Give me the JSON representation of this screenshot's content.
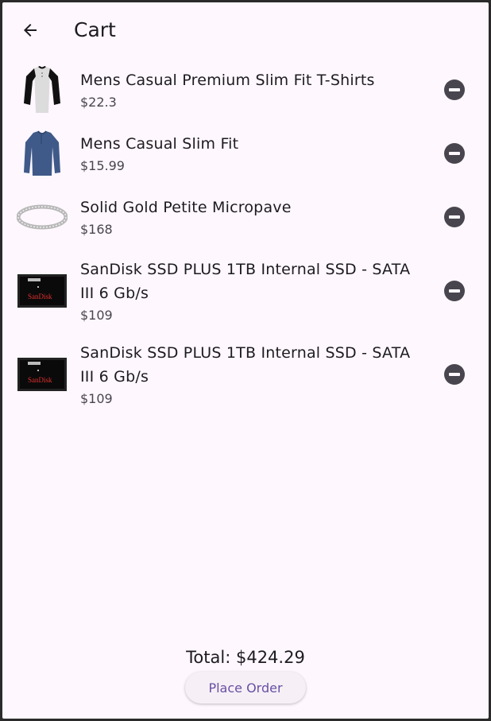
{
  "appbar": {
    "title": "Cart",
    "back_icon": "arrow-left-icon"
  },
  "items": [
    {
      "name": "Mens Casual Premium Slim Fit T-Shirts",
      "price": "$22.3",
      "image": "raglan-tshirt-image"
    },
    {
      "name": "Mens Casual Slim Fit",
      "price": "$15.99",
      "image": "blue-longsleeve-image"
    },
    {
      "name": "Solid Gold Petite Micropave",
      "price": "$168",
      "image": "silver-bracelet-image"
    },
    {
      "name": "SanDisk SSD PLUS 1TB Internal SSD - SATA III 6 Gb/s",
      "price": "$109",
      "image": "sandisk-ssd-image",
      "image_text": "SanDisk"
    },
    {
      "name": "SanDisk SSD PLUS 1TB Internal SSD - SATA III 6 Gb/s",
      "price": "$109",
      "image": "sandisk-ssd-image",
      "image_text": "SanDisk"
    }
  ],
  "remove_icon": "remove-circle-icon",
  "footer": {
    "total": "Total: $424.29",
    "place_order_label": "Place Order"
  },
  "colors": {
    "background": "#fef7fe",
    "primary": "#6750a4",
    "icon": "#49454f",
    "button_bg": "#f6eff6"
  }
}
